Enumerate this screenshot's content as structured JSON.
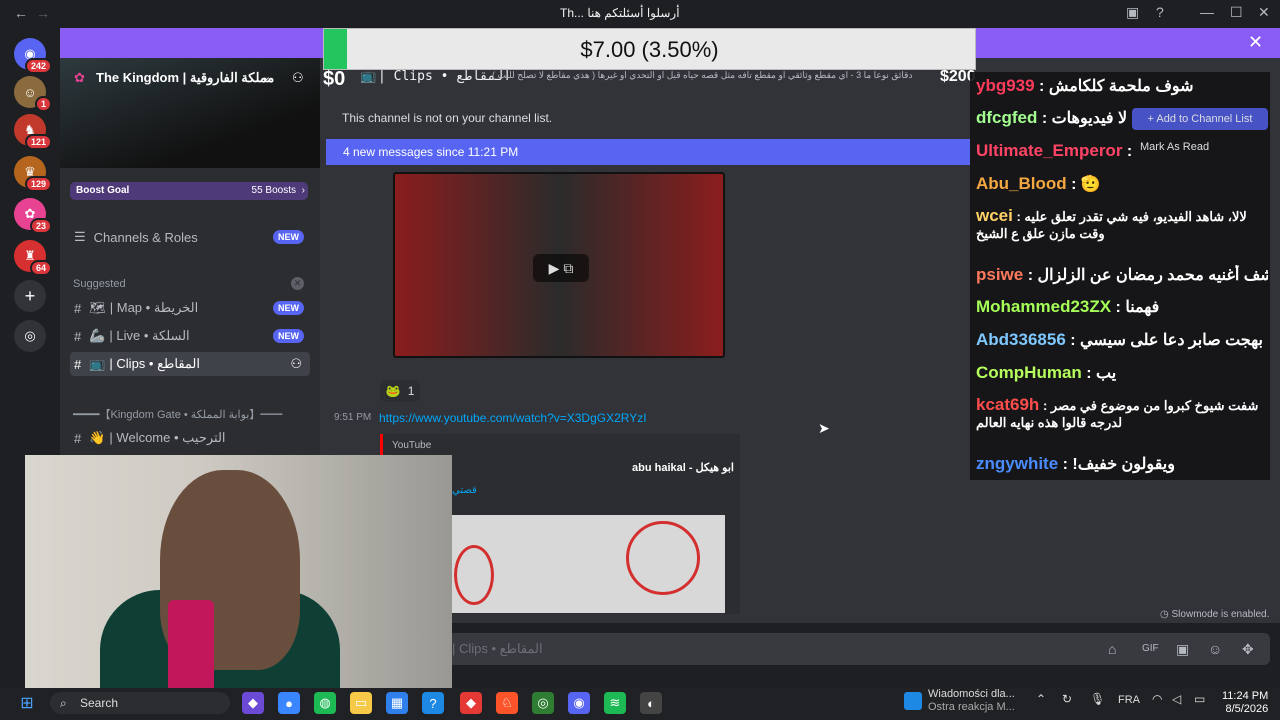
{
  "window": {
    "title": "Th... أرسلوا أسئلتكم هنا"
  },
  "titlebar": {
    "back_glyph": "←",
    "fwd_glyph": "→",
    "min_glyph": "—",
    "max_glyph": "☐",
    "close_glyph": "✕"
  },
  "rail": {
    "servers": [
      {
        "badge": "242",
        "color": "#5865f2",
        "glyph": "◉"
      },
      {
        "badge": "1",
        "color": "#8b6b3d",
        "glyph": "☺"
      },
      {
        "badge": "121",
        "color": "#c0392b",
        "glyph": "♞"
      },
      {
        "badge": "129",
        "color": "#b5651d",
        "glyph": "♛"
      },
      {
        "badge": "23",
        "color": "#e84393",
        "glyph": "✿"
      },
      {
        "badge": "64",
        "color": "#d63031",
        "glyph": "♜"
      }
    ],
    "add_glyph": "+",
    "explore_glyph": "◎"
  },
  "donation": {
    "label": "$7.00 (3.50%)",
    "progress_percent": 3.5,
    "left_amount": "$0",
    "right_amount": "$200"
  },
  "sidebar": {
    "server_name": "The Kingdom | مملكة الفاروقية",
    "boost_label": "Boost Goal",
    "boost_count": "55 Boosts",
    "channels_roles": "Channels & Roles",
    "new_tag": "NEW",
    "suggested_label": "Suggested",
    "items": [
      {
        "label": "| Map • الخريطة",
        "emoji": "🗺",
        "new": true
      },
      {
        "label": "| Live • السلكة",
        "emoji": "🦾",
        "new": true
      },
      {
        "label": "| Clips • المقاطع",
        "emoji": "📺",
        "new": false
      }
    ],
    "category": "━━━━【Kingdom Gate • بوابة المملكة】━━",
    "welcome": "| Welcome • الترحيب"
  },
  "main": {
    "channel_name": "| Clips • المقاطع",
    "channel_topic": "دقائق نوعا ما 3 - اي مقطع وثائقي او مقطع تافه مثل قصه حياه قبل او التحدي او غيرها ( هذي مقاطع لا تصلح للبث )",
    "notice": "This channel is not on your channel list.",
    "add_channel_list": "+ Add to Channel List",
    "new_messages": "4 new messages since 11:21 PM",
    "mark_as_read": "Mark As Read",
    "reaction_emoji": "🐸",
    "reaction_count": "1",
    "message_time": "9:51 PM",
    "message_link": "https://www.youtube.com/watch?v=X3DgGX2RYzI",
    "embed_provider": "YouTube",
    "embed_author": "abu haikal - ابو هيكل",
    "embed_title": "قصتي",
    "slowmode": "Slowmode is enabled.",
    "composer_placeholder": "| Clips • المقاطع"
  },
  "chat": [
    {
      "user": "ybg939",
      "color": "#ff3b5c",
      "text": "شوف ملحمة كلكامش"
    },
    {
      "user": "dfcgfed",
      "color": "#a3ff8f",
      "text": "لا فيديوهات"
    },
    {
      "user": "Ultimate_Emperor",
      "color": "#ff4466",
      "text": ""
    },
    {
      "user": "Abu_Blood",
      "color": "#f5a742",
      "text": "🫡"
    },
    {
      "user": "wcei",
      "color": "#ffd166",
      "text": "لالا، شاهد الفيديو، فيه شي تقدر تعلق عليه وقت مازن علق ع الشيخ"
    },
    {
      "user": "psiwe",
      "color": "#ff7a5c",
      "text": "شف أغنيه محمد رمضان عن الزلزال"
    },
    {
      "user": "Mohammed23ZX",
      "color": "#a6ff57",
      "text": "فهمنا"
    },
    {
      "user": "Abd336856",
      "color": "#7ec8ff",
      "text": "بهجت صابر دعا على سيسي"
    },
    {
      "user": "CompHuman",
      "color": "#b6ff5c",
      "text": "يب"
    },
    {
      "user": "kcat69h",
      "color": "#ff4d4d",
      "text": "شفت شيوخ كبروا من موضوع في مصر لدرجه قالوا هذه نهايه العالم"
    },
    {
      "user": "zngywhite",
      "color": "#4a8cff",
      "text": "!ويقولون خفيف"
    }
  ],
  "taskbar": {
    "search": "Search",
    "widget_title": "Wiadomości dla...",
    "widget_sub": "Ostra reakcja M...",
    "lang": "FRA",
    "time": "11:24 PM",
    "date": "8/5/2026",
    "apps": [
      {
        "color": "#6b4bd6",
        "glyph": "◆"
      },
      {
        "color": "#3a86ff",
        "glyph": "●"
      },
      {
        "color": "#1db954",
        "glyph": "◍"
      },
      {
        "color": "#f7c948",
        "glyph": "▭"
      },
      {
        "color": "#2f80ed",
        "glyph": "▦"
      },
      {
        "color": "#1e88e5",
        "glyph": "?"
      },
      {
        "color": "#e53935",
        "glyph": "◆"
      },
      {
        "color": "#fb542b",
        "glyph": "♘"
      },
      {
        "color": "#2e7d32",
        "glyph": "◎"
      },
      {
        "color": "#5865f2",
        "glyph": "◉"
      },
      {
        "color": "#1db954",
        "glyph": "≋"
      },
      {
        "color": "#444",
        "glyph": "◐"
      }
    ]
  }
}
